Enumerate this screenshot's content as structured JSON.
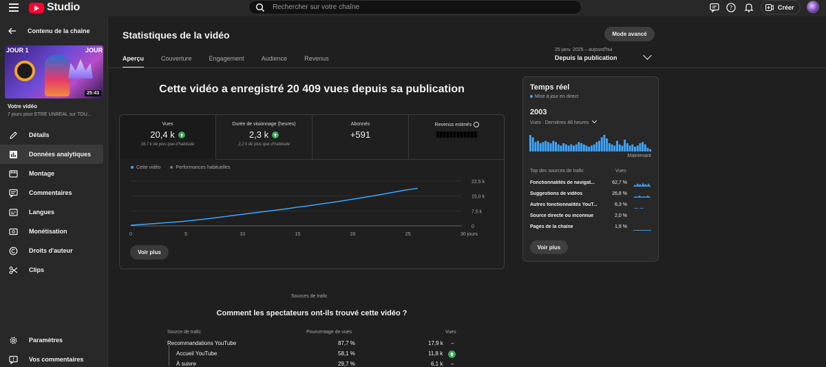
{
  "header": {
    "logo_text": "Studio",
    "search_placeholder": "Rechercher sur votre chaîne",
    "create_label": "Créer"
  },
  "sidebar": {
    "back_label": "Contenu de la chaîne",
    "thumbnail": {
      "left_text": "JOUR 1",
      "right_text": "JOUR",
      "duration": "25:43"
    },
    "your_video_label": "Votre vidéo",
    "your_video_sub": "7 jours pour ÊTRE UNREAL sur TOU...",
    "items": [
      {
        "label": "Détails",
        "icon": "pencil-icon"
      },
      {
        "label": "Données analytiques",
        "icon": "analytics-icon",
        "active": true
      },
      {
        "label": "Montage",
        "icon": "film-icon"
      },
      {
        "label": "Commentaires",
        "icon": "comment-icon"
      },
      {
        "label": "Langues",
        "icon": "subtitles-icon"
      },
      {
        "label": "Monétisation",
        "icon": "dollar-icon"
      },
      {
        "label": "Droits d'auteur",
        "icon": "copyright-icon"
      },
      {
        "label": "Clips",
        "icon": "scissors-icon"
      }
    ],
    "bottom_items": [
      {
        "label": "Paramètres",
        "icon": "gear-icon"
      },
      {
        "label": "Vos commentaires",
        "icon": "feedback-icon"
      }
    ]
  },
  "main": {
    "title": "Statistiques de la vidéo",
    "advanced_mode": "Mode avancé",
    "tabs": [
      "Aperçu",
      "Couverture",
      "Engagement",
      "Audience",
      "Revenus"
    ],
    "date_range": {
      "dates": "25 janv. 2025 – aujourd'hui",
      "label": "Depuis la publication"
    },
    "headline": "Cette vidéo a enregistré 20 409 vues depuis sa publication",
    "metrics": [
      {
        "label": "Vues",
        "value": "20,4 k",
        "sub": "18,7 k de plus que d'habitude",
        "up": true
      },
      {
        "label": "Durée de visionnage (heures)",
        "value": "2,3 k",
        "sub": "2,2 k de plus que d'habitude",
        "up": true
      },
      {
        "label": "Abonnés",
        "value": "+591",
        "sub": ""
      },
      {
        "label": "Revenus estimés",
        "value": "",
        "sub": "",
        "redacted": true
      }
    ],
    "legend": [
      "Cette vidéo",
      "Performances habituelles"
    ],
    "see_more": "Voir plus"
  },
  "chart_data": {
    "type": "line",
    "xlabel": "",
    "ylabel": "",
    "x_ticks": [
      "0",
      "5",
      "10",
      "15",
      "20",
      "25",
      "30 jours"
    ],
    "y_ticks": [
      "0",
      "7,5 k",
      "15,0 k",
      "22,5 k"
    ],
    "xlim": [
      0,
      30
    ],
    "ylim": [
      0,
      22500
    ],
    "series": [
      {
        "name": "Cette vidéo",
        "color": "#3ea6ff",
        "x": [
          0,
          1,
          2,
          3,
          4,
          5,
          6,
          7,
          8,
          9,
          10,
          11,
          12,
          13,
          14,
          15,
          16,
          17,
          18,
          19,
          20,
          21,
          22,
          23,
          24,
          25,
          26
        ],
        "y": [
          300,
          700,
          1100,
          1500,
          1900,
          2400,
          3000,
          3600,
          4300,
          5000,
          5700,
          6400,
          7100,
          7800,
          8500,
          9300,
          10000,
          10800,
          11600,
          12400,
          13300,
          14200,
          15100,
          16100,
          17100,
          18100,
          18900
        ]
      }
    ]
  },
  "realtime": {
    "title": "Temps réel",
    "live_label": "Mise à jour en direct",
    "count": "2003",
    "sub": "Vues · Dernières 48 heures",
    "now_label": "Maintenant",
    "bars": [
      14,
      12,
      8,
      9,
      7,
      8,
      9,
      8,
      7,
      9,
      8,
      6,
      5,
      7,
      6,
      5,
      6,
      5,
      6,
      8,
      7,
      6,
      5,
      4,
      5,
      6,
      8,
      9,
      12,
      14,
      11,
      7,
      6,
      5,
      9,
      6,
      5,
      10,
      7,
      5,
      6,
      4,
      5,
      7,
      8,
      6,
      3,
      2
    ],
    "table_header": {
      "source": "Top des sources de trafic",
      "views": "Vues"
    },
    "sources": [
      {
        "name": "Fonctionnalités de navigat...",
        "pct": "62,7 %"
      },
      {
        "name": "Suggestions de vidéos",
        "pct": "26,8 %"
      },
      {
        "name": "Autres fonctionnalités YouT...",
        "pct": "6,3 %"
      },
      {
        "name": "Source directe ou inconnue",
        "pct": "2,0 %"
      },
      {
        "name": "Pages de la chaîne",
        "pct": "1,9 %"
      }
    ],
    "see_more": "Voir plus"
  },
  "traffic": {
    "section_label": "Sources de trafic",
    "title": "Comment les spectateurs ont-ils trouvé cette vidéo ?",
    "headers": {
      "source": "Source de trafic",
      "pct": "Pourcentage de vues",
      "views": "Vues"
    },
    "rows": [
      {
        "source": "Recommandations YouTube",
        "pct": "87,7 %",
        "views": "17,9 k",
        "trend": "–",
        "level": 0
      },
      {
        "source": "Accueil YouTube",
        "pct": "58,1 %",
        "views": "11,8 k",
        "trend": "up",
        "level": 1
      },
      {
        "source": "À suivre",
        "pct": "29,7 %",
        "views": "6,1 k",
        "trend": "–",
        "level": 1
      }
    ]
  }
}
